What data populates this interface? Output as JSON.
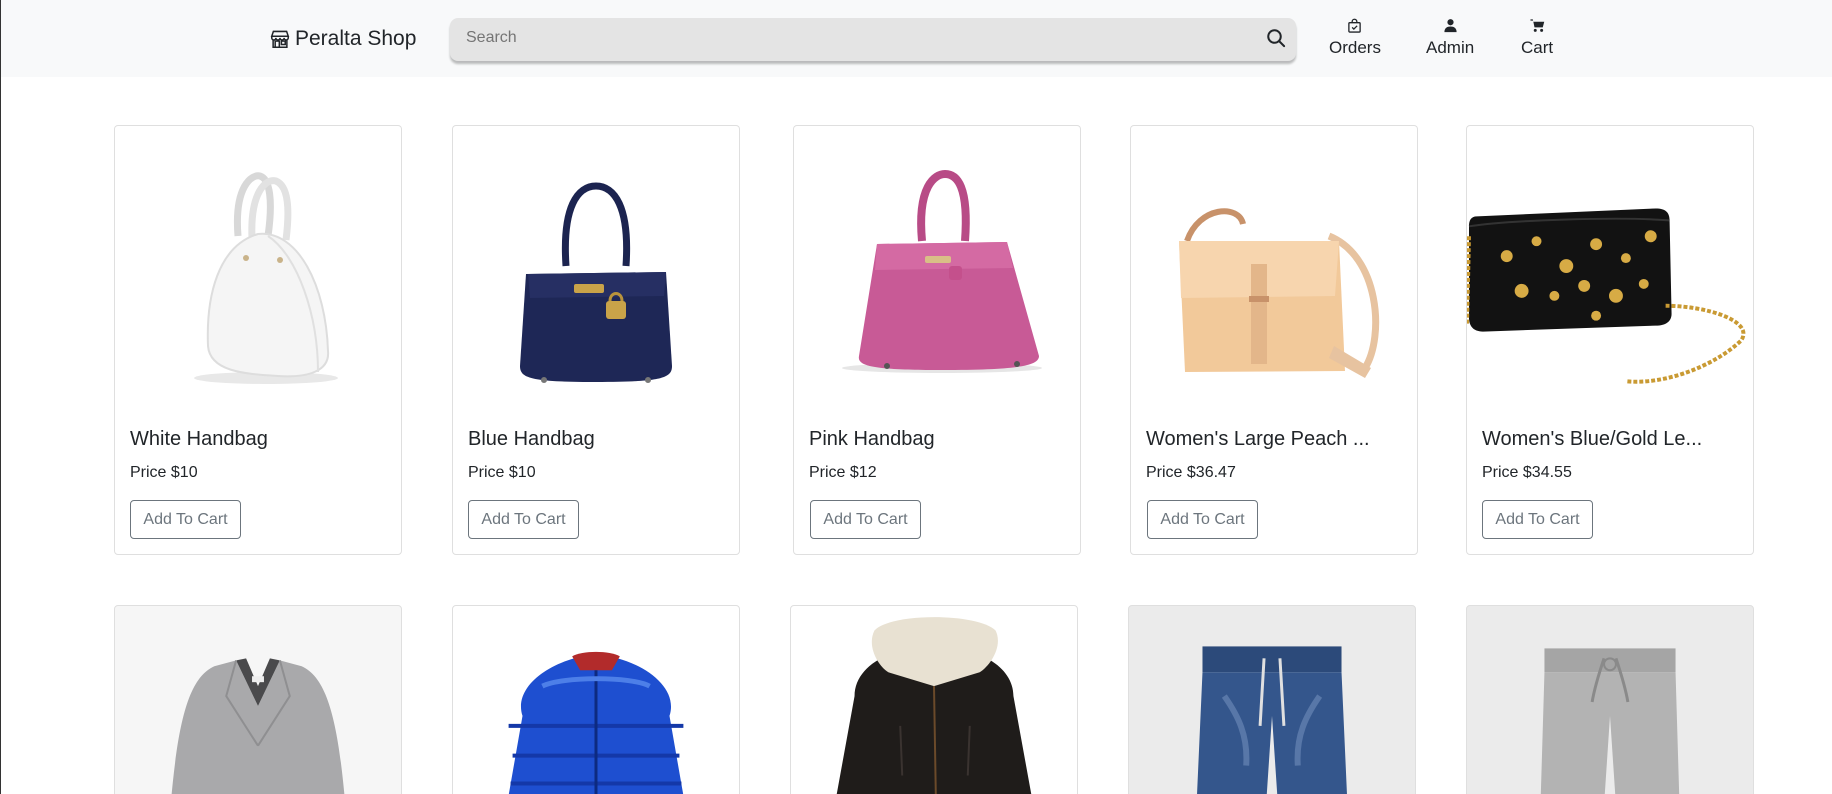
{
  "header": {
    "brand": "Peralta Shop",
    "search_placeholder": "Search",
    "nav": [
      {
        "label": "Orders",
        "icon": "bag-check-icon"
      },
      {
        "label": "Admin",
        "icon": "person-icon"
      },
      {
        "label": "Cart",
        "icon": "cart-icon"
      }
    ]
  },
  "products": [
    {
      "name": "White Handbag",
      "price": "Price $10",
      "button": "Add To Cart"
    },
    {
      "name": "Blue Handbag",
      "price": "Price $10",
      "button": "Add To Cart"
    },
    {
      "name": "Pink Handbag",
      "price": "Price $12",
      "button": "Add To Cart"
    },
    {
      "name": "Women's Large Peach ...",
      "price": "Price $36.47",
      "button": "Add To Cart"
    },
    {
      "name": "Women's Blue/Gold Le...",
      "price": "Price $34.55",
      "button": "Add To Cart"
    }
  ],
  "colors": {
    "navbar_bg": "#f8f9fa",
    "search_bg": "#e4e4e4",
    "button_border": "#6c757d"
  }
}
